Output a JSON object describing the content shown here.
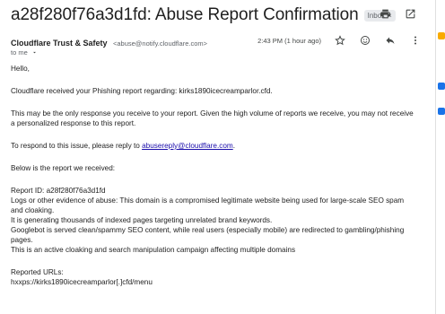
{
  "subject": "a28f280f76a3d1fd: Abuse Report Confirmation",
  "label_chip": "Inbox",
  "label_chip_close": "×",
  "sender": {
    "name": "Cloudflare Trust & Safety",
    "email": "<abuse@notify.cloudflare.com>",
    "recipient": "to me",
    "timestamp": "2:43 PM (1 hour ago)"
  },
  "icons": {
    "print": "printer-icon",
    "open_new": "open-in-new-window-icon",
    "star": "star-icon",
    "emoji": "emoji-reaction-icon",
    "reply": "reply-icon",
    "more": "more-vertical-icon",
    "recipient_details": "chevron-down-icon"
  },
  "body": {
    "greeting": "Hello,",
    "intro": "Cloudflare received your Phishing report regarding: kirks1890icecreamparlor.cfd.",
    "notice": "This may be the only response you receive to your report. Given the high volume of reports we receive, you may not receive a personalized response to this report.",
    "reply_prefix": "To respond to this issue, please reply to ",
    "reply_email": "abusereply@cloudflare.com",
    "reply_suffix": ".",
    "report_intro": "Below is the report we received:",
    "report_id": "Report ID: a28f280f76a3d1fd",
    "evidence_1": "Logs or other evidence of abuse:  This domain is a compromised legitimate website being used for large-scale SEO spam and cloaking.",
    "evidence_2": "It is generating thousands of indexed pages targeting unrelated brand keywords.",
    "evidence_3": "Googlebot is served clean/spammy SEO content, while real users (especially mobile) are redirected to gambling/phishing pages.",
    "evidence_4": "This is an active cloaking and search manipulation campaign affecting multiple domains",
    "urls_label": "Reported URLs:",
    "url_1": "hxxps://kirks1890icecreamparlor[.]cfd/menu"
  },
  "colors": {
    "link": "#1a0dab",
    "rail_yellow": "#f9ab00",
    "rail_blue": "#1a73e8"
  }
}
